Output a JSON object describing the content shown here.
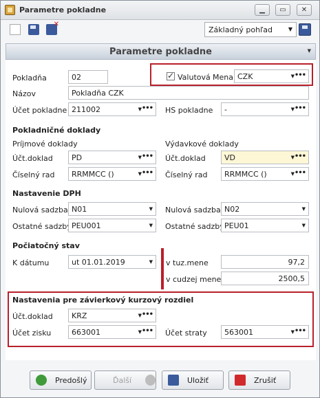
{
  "window": {
    "title": "Parametre pokladne"
  },
  "toolbar": {
    "view": "Základný pohľad"
  },
  "header": {
    "title": "Parametre pokladne"
  },
  "form": {
    "pokladna_label": "Pokladňa",
    "pokladna_value": "02",
    "valutova_label": "Valutová",
    "valutova_checked": true,
    "mena_label": "Mena",
    "mena_value": "CZK",
    "nazov_label": "Názov",
    "nazov_value": "Pokladňa CZK",
    "ucet_label": "Účet pokladne",
    "ucet_value": "211002",
    "hs_label": "HS pokladne",
    "hs_value": "-",
    "doklady_section": "Pokladničné doklady",
    "prijmove_label": "Príjmové doklady",
    "vydavkove_label": "Výdavkové doklady",
    "uct_doklad_label": "Účt.doklad",
    "prijem_doklad": "PD",
    "vydaj_doklad": "VD",
    "ciselny_rad_label": "Číselný rad",
    "prijem_rad": "RRMMCC ()",
    "vydaj_rad": "RRMMCC ()",
    "dph_section": "Nastavenie DPH",
    "nulova_label": "Nulová sadzba",
    "nulova_1": "N01",
    "nulova_2": "N02",
    "ostatne_label": "Ostatné sadzby",
    "ostatne_1": "PEU001",
    "ostatne_2": "PEU01",
    "pociatocny_section": "Počiatočný stav",
    "k_datumu_label": "K dátumu",
    "k_datumu_value": "ut 01.01.2019",
    "tuz_label": "v tuz.mene",
    "tuz_value": "97,2",
    "cudz_label": "v cudzej mene",
    "cudz_value": "2500,5",
    "zavierka_section": "Nastavenia pre závierkový kurzový rozdiel",
    "zav_doklad_label": "Účt.doklad",
    "zav_doklad_value": "KRZ",
    "zisk_label": "Účet zisku",
    "zisk_value": "663001",
    "strata_label": "Účet straty",
    "strata_value": "563001"
  },
  "buttons": {
    "prev": "Predošlý",
    "next": "Ďalší",
    "save": "Uložiť",
    "cancel": "Zrušiť"
  },
  "colors": {
    "highlight": "#b8202a",
    "band": "#c9d1dc",
    "yellow_field": "#fdf7d6"
  }
}
